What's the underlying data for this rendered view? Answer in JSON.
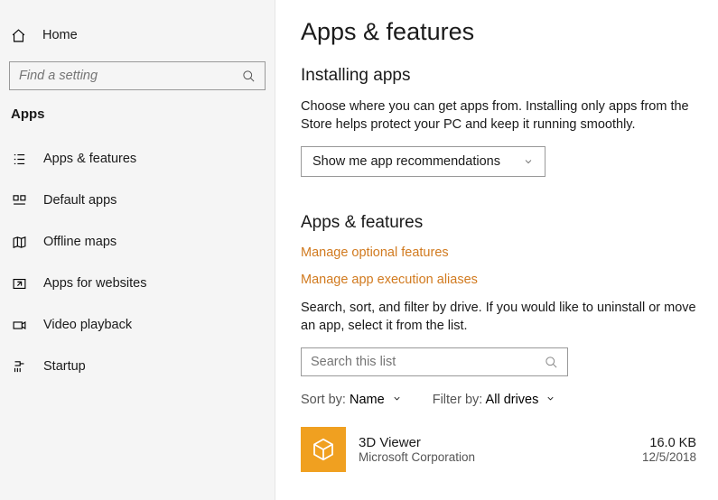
{
  "sidebar": {
    "home_label": "Home",
    "search_placeholder": "Find a setting",
    "section_title": "Apps",
    "items": [
      {
        "label": "Apps & features"
      },
      {
        "label": "Default apps"
      },
      {
        "label": "Offline maps"
      },
      {
        "label": "Apps for websites"
      },
      {
        "label": "Video playback"
      },
      {
        "label": "Startup"
      }
    ]
  },
  "main": {
    "page_title": "Apps & features",
    "installing": {
      "heading": "Installing apps",
      "description": "Choose where you can get apps from. Installing only apps from the Store helps protect your PC and keep it running smoothly.",
      "dropdown_value": "Show me app recommendations"
    },
    "apps_features": {
      "heading": "Apps & features",
      "link_optional": "Manage optional features",
      "link_aliases": "Manage app execution aliases",
      "list_help": "Search, sort, and filter by drive. If you would like to uninstall or move an app, select it from the list.",
      "search_placeholder": "Search this list",
      "sort_label": "Sort by:",
      "sort_value": "Name",
      "filter_label": "Filter by:",
      "filter_value": "All drives",
      "app": {
        "name": "3D Viewer",
        "publisher": "Microsoft Corporation",
        "size": "16.0 KB",
        "date": "12/5/2018"
      }
    }
  }
}
